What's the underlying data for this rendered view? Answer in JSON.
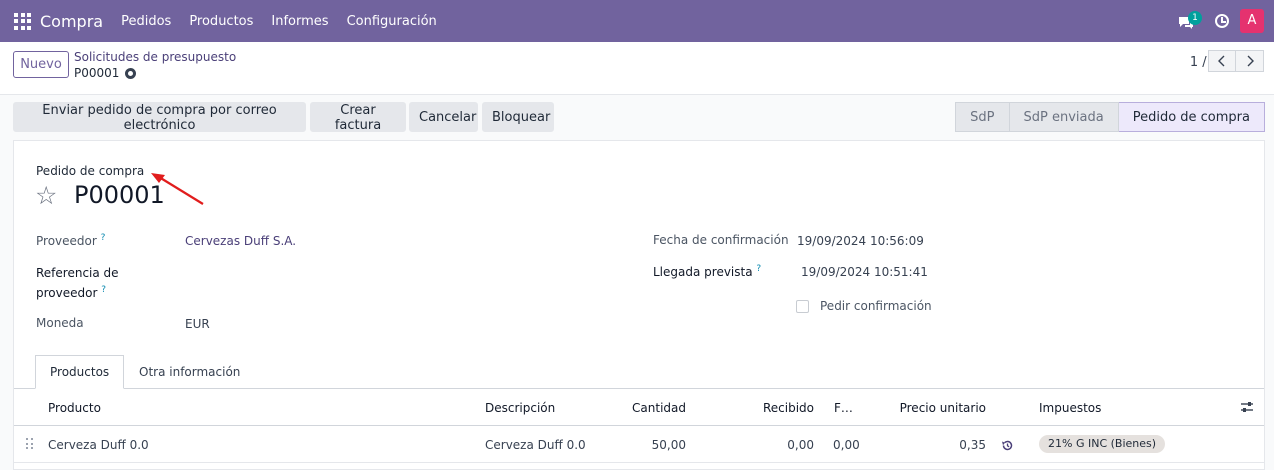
{
  "app": {
    "title": "Compra"
  },
  "menu": [
    "Pedidos",
    "Productos",
    "Informes",
    "Configuración"
  ],
  "systray": {
    "chat_count": "1",
    "avatar_letter": "A"
  },
  "control_panel": {
    "new_label": "Nuevo",
    "breadcrumb_parent": "Solicitudes de presupuesto",
    "breadcrumb_current": "P00001",
    "pager": "1 / 1"
  },
  "actions": {
    "send_email": "Enviar pedido de compra por correo electrónico",
    "create_invoice": "Crear factura",
    "cancel": "Cancelar",
    "lock": "Bloquear"
  },
  "statusbar": [
    "SdP",
    "SdP enviada",
    "Pedido de compra"
  ],
  "form": {
    "type_label": "Pedido de compra",
    "name": "P00001",
    "vendor_label": "Proveedor",
    "vendor_value": "Cervezas Duff S.A.",
    "vendor_ref_label_1": "Referencia de",
    "vendor_ref_label_2": "proveedor",
    "currency_label": "Moneda",
    "currency_value": "EUR",
    "confirm_date_label": "Fecha de confirmación",
    "confirm_date_value": "19/09/2024 10:56:09",
    "expected_arrival_label": "Llegada prevista",
    "expected_arrival_value": "19/09/2024 10:51:41",
    "ask_confirmation_label": "Pedir confirmación",
    "help_mark": "?"
  },
  "tabs": [
    "Productos",
    "Otra información"
  ],
  "table": {
    "headers": [
      "Producto",
      "Descripción",
      "Cantidad",
      "Recibido",
      "F…",
      "Precio unitario",
      "Impuestos"
    ],
    "rows": [
      {
        "product": "Cerveza Duff 0.0",
        "description": "Cerveza Duff 0.0",
        "qty": "50,00",
        "received": "0,00",
        "billed": "0,00",
        "price": "0,35",
        "tax": "21% G INC (Bienes)"
      }
    ]
  },
  "colors": {
    "brand": "#71639e",
    "status_active": "#ede9fb",
    "annotation_arrow": "#e11d1d"
  }
}
